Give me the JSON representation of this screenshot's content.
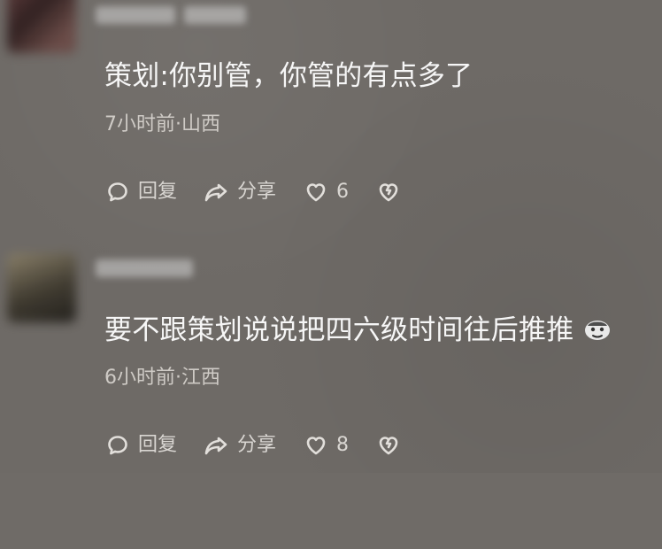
{
  "comments": [
    {
      "text": "策划:你别管，你管的有点多了",
      "meta": "7小时前·山西",
      "actions": {
        "reply_label": "回复",
        "share_label": "分享",
        "like_count": "6"
      }
    },
    {
      "text": "要不跟策划说说把四六级时间往后推推",
      "meta": "6小时前·江西",
      "actions": {
        "reply_label": "回复",
        "share_label": "分享",
        "like_count": "8"
      },
      "emoji_icon": "meme-emoji-icon"
    }
  ],
  "colors": {
    "background": "#6e6a66",
    "comment_text": "#f6f6f6",
    "meta_text": "#cfcbc6",
    "action_text": "#d9d6d2"
  },
  "icons": {
    "reply": "comment-bubble-icon",
    "share": "share-arrow-icon",
    "like": "heart-icon",
    "dislike": "broken-heart-icon"
  }
}
